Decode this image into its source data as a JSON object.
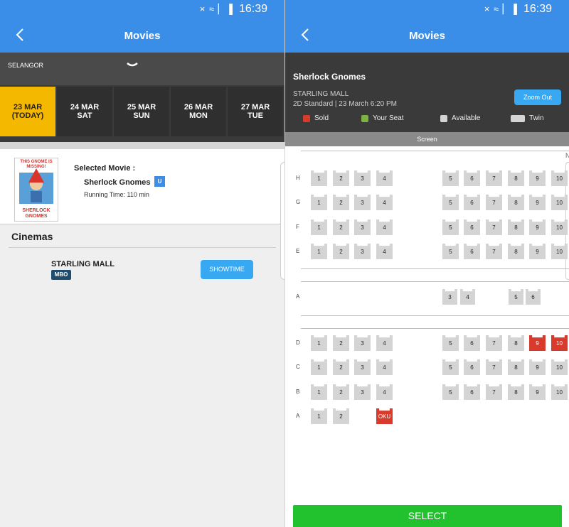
{
  "status_bar": {
    "time": "16:39",
    "icons": "× ≈ ▏▐"
  },
  "left": {
    "app_title": "Movies",
    "region": "SELANGOR",
    "dates": [
      {
        "l1": "23 MAR",
        "l2": "(TODAY)",
        "active": true
      },
      {
        "l1": "24 MAR",
        "l2": "SAT"
      },
      {
        "l1": "25 MAR",
        "l2": "SUN"
      },
      {
        "l1": "26 MAR",
        "l2": "MON"
      },
      {
        "l1": "27 MAR",
        "l2": "TUE"
      }
    ],
    "selected_movie_label": "Selected Movie :",
    "movie_name": "Sherlock Gnomes",
    "rating": "U",
    "running_time": "Running Time: 110 min",
    "poster_tagline": "THIS GNOME IS MISSING!",
    "poster_title": "SHERLOCK GNOMES",
    "cinemas_title": "Cinemas",
    "cinema_name": "STARLING MALL",
    "cinema_badge": "MBO",
    "showtime_label": "SHOWTIME"
  },
  "right": {
    "app_title": "Movies",
    "movie_title": "Sherlock Gnomes",
    "cinema": "STARLING MALL",
    "details": "2D Standard | 23 March 6:20 PM",
    "zoom_label": "Zoom Out",
    "legend": [
      {
        "label": "Sold",
        "color": "#d83a2b"
      },
      {
        "label": "Your Seat",
        "color": "#7cb342"
      },
      {
        "label": "Available",
        "color": "#d4d4d4"
      },
      {
        "label": "Twin",
        "color": "#d4d4d4"
      }
    ],
    "screen_label": "Screen",
    "corner_letter": "N",
    "select_label": "SELECT",
    "rows": [
      {
        "label": "H",
        "seats": [
          "1",
          "2",
          "3",
          "4",
          "5",
          "6",
          "7",
          "8",
          "9",
          "10"
        ]
      },
      {
        "label": "G",
        "seats": [
          "1",
          "2",
          "3",
          "4",
          "5",
          "6",
          "7",
          "8",
          "9",
          "10"
        ]
      },
      {
        "label": "F",
        "seats": [
          "1",
          "2",
          "3",
          "4",
          "5",
          "6",
          "7",
          "8",
          "9",
          "10"
        ]
      },
      {
        "label": "E",
        "seats": [
          "1",
          "2",
          "3",
          "4",
          "5",
          "6",
          "7",
          "8",
          "9",
          "10"
        ]
      },
      {
        "label": "A",
        "seats": [
          "3",
          "4",
          "5",
          "6"
        ]
      },
      {
        "label": "D",
        "seats": [
          "1",
          "2",
          "3",
          "4",
          "5",
          "6",
          "7",
          "8",
          "9",
          "10"
        ],
        "sold": [
          "9",
          "10"
        ]
      },
      {
        "label": "C",
        "seats": [
          "1",
          "2",
          "3",
          "4",
          "5",
          "6",
          "7",
          "8",
          "9",
          "10"
        ]
      },
      {
        "label": "B",
        "seats": [
          "1",
          "2",
          "3",
          "4",
          "5",
          "6",
          "7",
          "8",
          "9",
          "10"
        ]
      },
      {
        "label": "A",
        "seats": [
          "1",
          "2",
          "OKU"
        ],
        "sold": [
          "OKU"
        ]
      }
    ]
  }
}
